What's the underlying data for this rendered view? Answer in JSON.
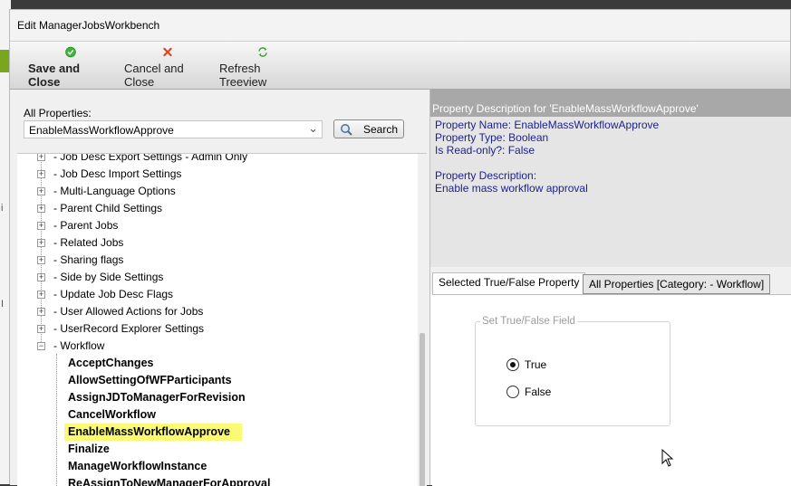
{
  "window": {
    "title": "Edit ManagerJobsWorkbench"
  },
  "toolbar": {
    "save_label": "Save and Close",
    "cancel_label": "Cancel and Close",
    "refresh_label": "Refresh Treeview"
  },
  "left": {
    "all_properties_label": "All Properties:",
    "selected_property": "EnableMassWorkflowApprove",
    "search_label": "Search"
  },
  "tree": {
    "nodes": [
      "- Job Desc Export Settings - Admin Only",
      "- Job Desc Import Settings",
      "- Multi-Language Options",
      "- Parent Child Settings",
      "- Parent Jobs",
      "- Related Jobs",
      "- Sharing flags",
      "- Side by Side Settings",
      "- Update Job Desc Flags",
      "- User Allowed Actions for Jobs",
      "- UserRecord Explorer Settings",
      "- Workflow"
    ],
    "workflow_children": [
      "AcceptChanges",
      "AllowSettingOfWFParticipants",
      "AssignJDToManagerForRevision",
      "CancelWorkflow",
      "EnableMassWorkflowApprove",
      "Finalize",
      "ManageWorkflowInstance",
      "ReAssignToNewManagerForApproval"
    ],
    "highlight_color": "#fbfa74"
  },
  "description": {
    "header": "Property Description for 'EnableMassWorkflowApprove'",
    "name_line": "Property Name: EnableMassWorkflowApprove",
    "type_line": "Property Type: Boolean",
    "readonly_line": "Is Read-only?: False",
    "desc_label": "Property Description:",
    "desc_text": "Enable mass workflow approval"
  },
  "tabs": {
    "active": "Selected True/False Property",
    "inactive": "All Properties [Category: - Workflow]"
  },
  "field": {
    "group_title": "Set True/False Field",
    "true_label": "True",
    "false_label": "False",
    "selected": "True"
  }
}
